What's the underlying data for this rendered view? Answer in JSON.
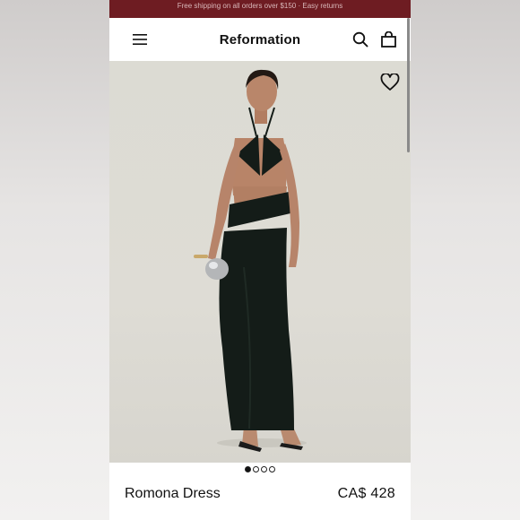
{
  "promo": {
    "text": "Free shipping on all orders over $150 · Easy returns"
  },
  "header": {
    "brand": "Reformation",
    "menu_icon": "menu-icon",
    "search_icon": "search-icon",
    "bag_icon": "bag-icon"
  },
  "product": {
    "name": "Romona Dress",
    "price": "CA$ 428",
    "wishlist_icon": "heart-icon",
    "image_description": "model-in-black-halter-cutout-maxi-dress"
  },
  "carousel": {
    "total": 4,
    "active": 1
  },
  "colors": {
    "promo_bar": "#6e1c22",
    "dress": "#141c18",
    "hero_bg": "#dcdbd3"
  }
}
